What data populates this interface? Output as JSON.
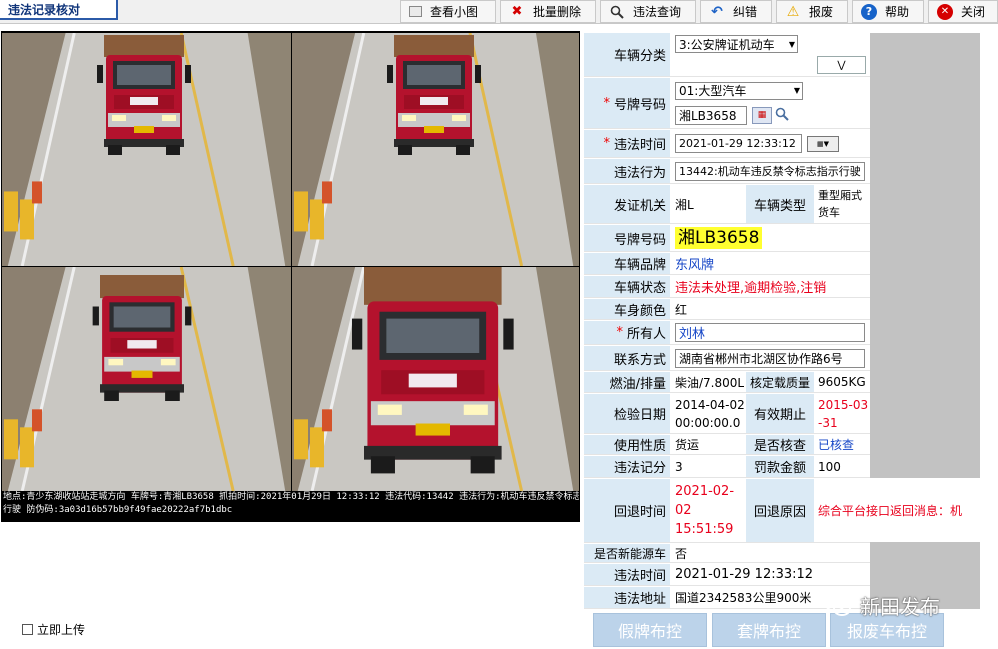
{
  "window": {
    "tab_title": "违法记录核对"
  },
  "toolbar": {
    "view_thumbnail": "查看小图",
    "batch_delete": "批量删除",
    "violation_query": "违法查询",
    "correct": "纠错",
    "scrap": "报废",
    "help": "帮助",
    "close": "关闭"
  },
  "image": {
    "caption_line1": "地点:青少东湖收站站走城方向 车牌号:青湘LB3658 抓拍时间:2021年01月29日 12:33:12 违法代码:13442 违法行为:机动车违反禁令标志指示",
    "caption_line2": "行驶 防伪码:3a03d16b57bb9f49fae20222af7b1dbc"
  },
  "form": {
    "vehicle_category": {
      "label": "车辆分类",
      "value": "3:公安牌证机动车"
    },
    "plate_type": {
      "label": "号牌号码",
      "value": "01:大型汽车"
    },
    "plate_input": "湘LB3658",
    "violation_time": {
      "label": "违法时间",
      "value": "2021-01-29 12:33:12"
    },
    "violation_act": {
      "label": "违法行为",
      "value": "13442:机动车违反禁令标志指示行驶"
    },
    "issuing_authority": {
      "label": "发证机关",
      "value": "湘L"
    },
    "vehicle_type": {
      "label": "车辆类型",
      "value": "重型厢式货车"
    },
    "plate_number": {
      "label": "号牌号码",
      "value": "湘LB3658"
    },
    "brand": {
      "label": "车辆品牌",
      "value": "东风牌"
    },
    "status": {
      "label": "车辆状态",
      "value": "违法未处理,逾期检验,注销"
    },
    "color": {
      "label": "车身颜色",
      "value": "红"
    },
    "owner": {
      "label": "所有人",
      "value": "刘林"
    },
    "contact": {
      "label": "联系方式",
      "value": "湖南省郴州市北湖区协作路6号"
    },
    "fuel": {
      "label": "燃油/排量",
      "value": "柴油/7.800L"
    },
    "rated_mass": {
      "label": "核定载质量",
      "value": "9605KG"
    },
    "inspection_date": {
      "label": "检验日期",
      "value": "2014-04-02 00:00:00.0"
    },
    "valid_until": {
      "label": "有效期止",
      "value": "2015-03-31"
    },
    "usage": {
      "label": "使用性质",
      "value": "货运"
    },
    "verified": {
      "label": "是否核查",
      "value": "已核查"
    },
    "points": {
      "label": "违法记分",
      "value": "3"
    },
    "fine": {
      "label": "罚款金额",
      "value": "100"
    },
    "return_time": {
      "label": "回退时间",
      "value": "2021-02-02 15:51:59"
    },
    "return_reason": {
      "label": "回退原因",
      "value": "综合平台接口返回消息：机"
    },
    "new_energy": {
      "label": "是否新能源车",
      "value": "否"
    },
    "violation_time2": {
      "label": "违法时间",
      "value": "2021-01-29 12:33:12"
    },
    "violation_place": {
      "label": "违法地址",
      "value": "国道2342583公里900米"
    }
  },
  "bottom": {
    "upload_now": "立即上传",
    "fake_plate_control": "假牌布控",
    "cloned_plate_control": "套牌布控",
    "scrapped_vehicle_control": "报废车布控"
  },
  "watermark": "新田发布",
  "colors": {
    "label_bg": "#dbeaf5",
    "required": "#e00000",
    "alert_red": "#e8001c",
    "link_blue": "#1747c7",
    "plate_highlight": "#ffff30",
    "truck_red": "#b4122d"
  }
}
